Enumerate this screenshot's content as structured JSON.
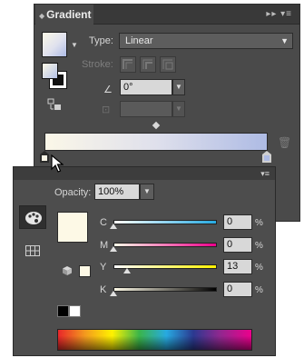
{
  "gradient_panel": {
    "title": "Gradient",
    "controls_glyphs": "▸▸ ▾≡",
    "type_label": "Type:",
    "type_value": "Linear",
    "stroke_label": "Stroke:",
    "angle_value": "0°",
    "gradient_stops": [
      {
        "color": "#fbf7e8",
        "location_percent": 0
      },
      {
        "color": "#aebbe4",
        "location_percent": 100
      }
    ]
  },
  "color_panel": {
    "opacity_label": "Opacity:",
    "opacity_value": "100%",
    "current_color": "#fdf9e6",
    "channels": [
      {
        "label": "C",
        "value": "0",
        "unit": "%",
        "level": 0
      },
      {
        "label": "M",
        "value": "0",
        "unit": "%",
        "level": 0
      },
      {
        "label": "Y",
        "value": "13",
        "unit": "%",
        "level": 13
      },
      {
        "label": "K",
        "value": "0",
        "unit": "%",
        "level": 0
      }
    ]
  },
  "icons": {
    "panel_collapse": "collapse-arrows-icon",
    "panel_menu": "panel-menu-icon",
    "angle": "angle-icon",
    "aspect": "aspect-ratio-icon",
    "trash": "trash-icon",
    "color_tab": "palette-icon",
    "swatches_tab": "swatch-grid-icon",
    "gamut": "out-of-gamut-cube-icon",
    "cursor": "mouse-pointer-icon"
  }
}
